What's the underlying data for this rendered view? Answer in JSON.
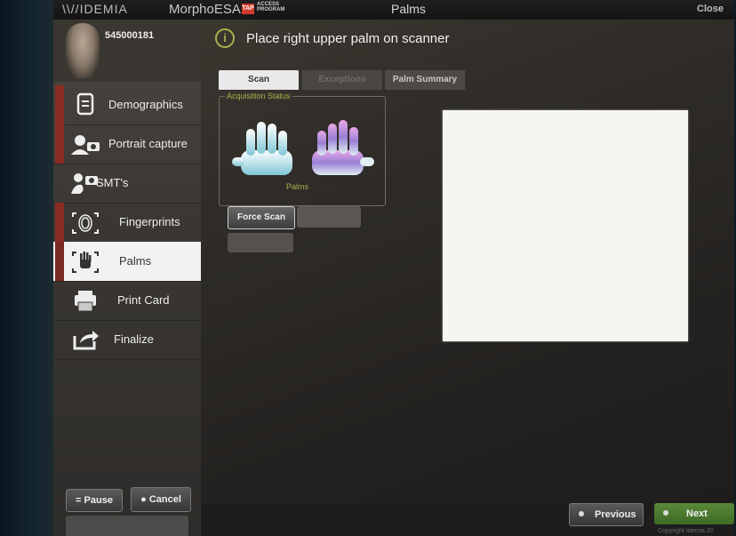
{
  "topbar": {
    "brand": "IDEMIA",
    "product": "MorphoESA",
    "tap_logo": "TAP",
    "tap_text": "ACCESS PROGRAM",
    "title": "Palms",
    "close_label": "Close"
  },
  "user": {
    "id": "545000181"
  },
  "sidebar": {
    "items": [
      {
        "label": "Demographics",
        "icon": "document-icon",
        "flag": true
      },
      {
        "label": "Portrait capture",
        "icon": "camera-person-icon",
        "flag": true
      },
      {
        "label": "SMT's",
        "icon": "tattoo-camera-icon",
        "flag": false
      },
      {
        "label": "Fingerprints",
        "icon": "fingerprint-icon",
        "flag": true
      },
      {
        "label": "Palms",
        "icon": "palm-icon",
        "flag": true,
        "active": true
      },
      {
        "label": "Print Card",
        "icon": "printer-icon",
        "flag": false
      },
      {
        "label": "Finalize",
        "icon": "export-icon",
        "flag": false
      }
    ],
    "pause_label": "= Pause",
    "cancel_label": "Cancel"
  },
  "main": {
    "instruction": "Place right upper palm on scanner",
    "tabs": [
      {
        "label": "Scan",
        "active": true
      },
      {
        "label": "Exceptions",
        "active": false
      },
      {
        "label": "Palm Summary",
        "active": false
      }
    ],
    "acquisition_status_label": "Acquisition Status",
    "palms_label": "Palms",
    "force_scan_label": "Force Scan"
  },
  "footer": {
    "previous_label": "Previous",
    "next_label": "Next",
    "copyright": "Copyright Idemia 20"
  },
  "colors": {
    "accent_green": "#a9b04a",
    "next_green": "#4a7a2e",
    "flag_red": "#8a2d22"
  }
}
